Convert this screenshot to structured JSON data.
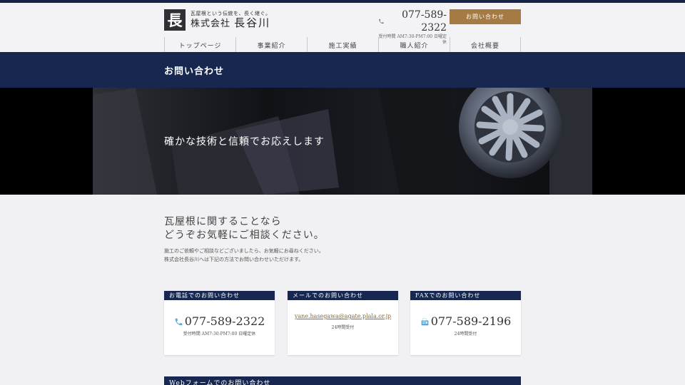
{
  "header": {
    "logo_glyph": "長",
    "tagline": "瓦屋根という伝統を、長く継ぐ。",
    "company_prefix": "株式会社",
    "company_name": "長谷川",
    "phone": "077-589-2322",
    "hours": "受付時間 AM7:30-PM7:00 日曜定休",
    "contact_button": "お問い合わせ"
  },
  "nav": {
    "items": [
      "トップページ",
      "事業紹介",
      "施工実績",
      "職人紹介",
      "会社概要"
    ]
  },
  "page": {
    "title": "お問い合わせ"
  },
  "hero": {
    "text": "確かな技術と信頼でお応えします"
  },
  "intro": {
    "title_line1": "瓦屋根に関することなら",
    "title_line2": "どうぞお気軽にご相談ください。",
    "body_line1": "施工のご依頼やご相談などございましたら、お気軽にお尋ねください。",
    "body_line2": "株式会社長谷川へは下記の方法でお問い合わせいただけます。"
  },
  "cards": {
    "phone": {
      "heading": "お電話でのお問い合わせ",
      "number": "077-589-2322",
      "sub": "受付時間 AM7:30-PM7:00 日曜定休"
    },
    "mail": {
      "heading": "メールでのお問い合わせ",
      "address": "yane.hasegawa@agate.plala.or.jp",
      "sub": "24時間受付"
    },
    "fax": {
      "heading": "FAXでのお問い合わせ",
      "number": "077-589-2196",
      "sub": "24時間受付"
    }
  },
  "web_form": {
    "heading": "Webフォームでのお問い合わせ"
  },
  "colors": {
    "navy": "#172750",
    "accent_gold": "#a57b43",
    "phone_icon_blue": "#5aa9d6",
    "background": "#f1f1f3"
  },
  "icons": {
    "phone": "phone-icon",
    "fax": "fax-icon",
    "hero": "hero-roof-tile-image"
  }
}
